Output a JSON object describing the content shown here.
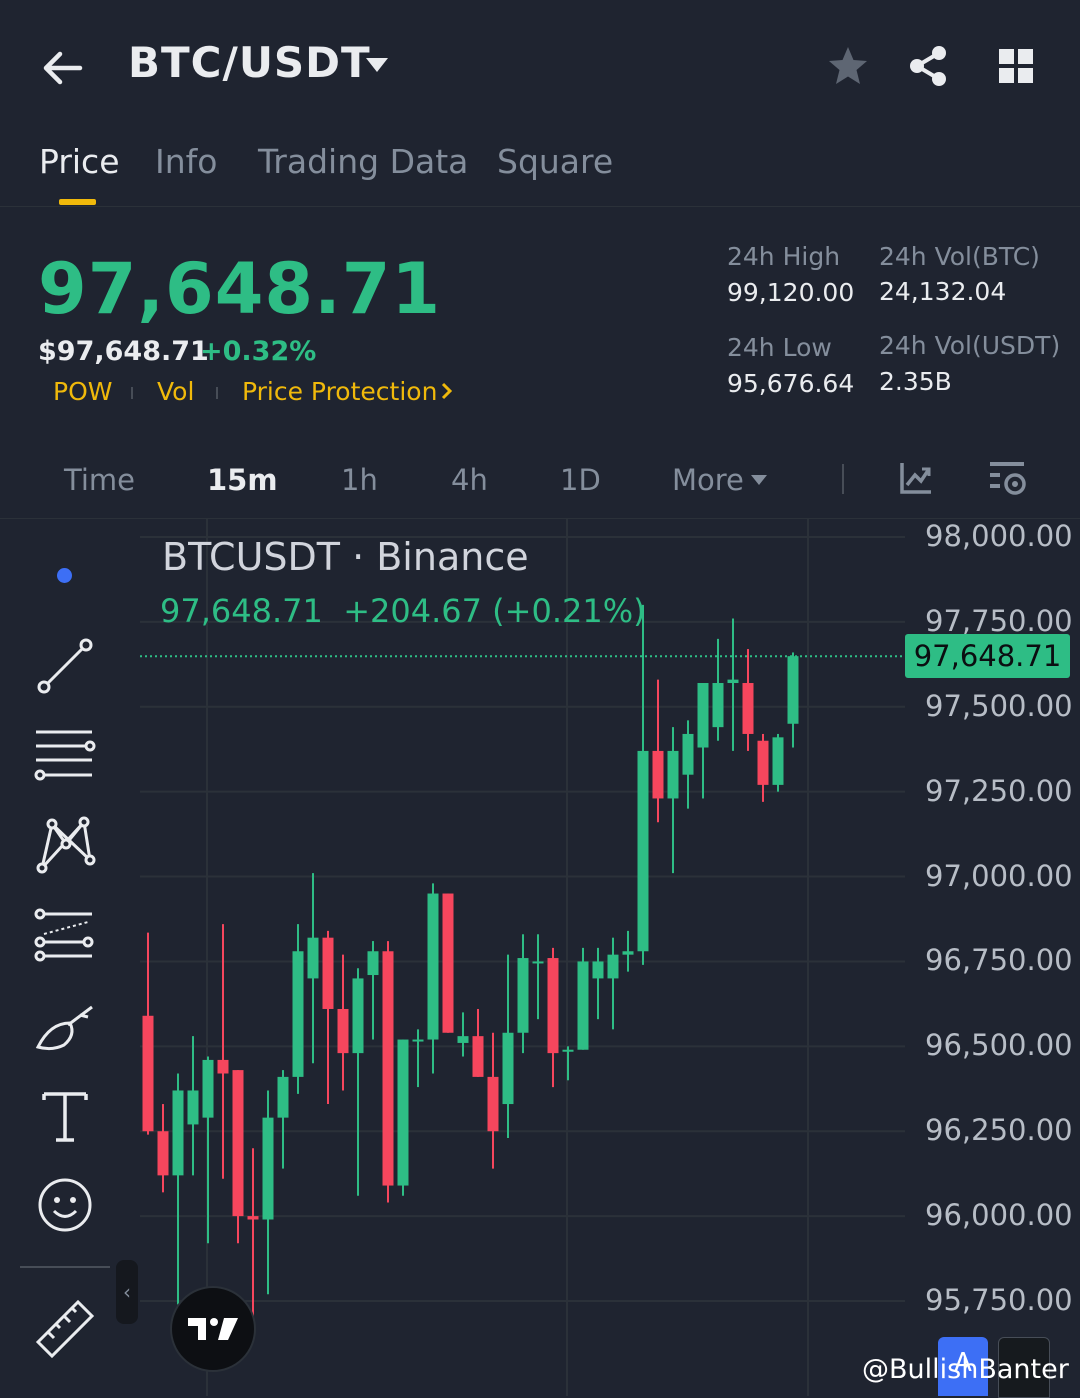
{
  "header": {
    "pair": "BTC/USDT",
    "tabs": [
      "Price",
      "Info",
      "Trading Data",
      "Square"
    ],
    "active_tab": "Price"
  },
  "ticker": {
    "last_price": "97,648.71",
    "usd_price": "$97,648.71",
    "change_pct": "+0.32%",
    "tags": [
      "POW",
      "Vol",
      "Price Protection"
    ],
    "stats": {
      "high_label": "24h High",
      "high_value": "99,120.00",
      "low_label": "24h Low",
      "low_value": "95,676.64",
      "vol_btc_label": "24h Vol(BTC)",
      "vol_btc_value": "24,132.04",
      "vol_usdt_label": "24h Vol(USDT)",
      "vol_usdt_value": "2.35B"
    }
  },
  "intervals": {
    "items": [
      "Time",
      "15m",
      "1h",
      "4h",
      "1D",
      "More"
    ],
    "active": "15m"
  },
  "chart": {
    "title": "BTCUSDT · Binance",
    "ohlc_line": "97,648.71  +204.67 (+0.21%)",
    "current_price_tag": "97,648.71",
    "current_price": 97648.71,
    "y_labels": [
      "98,000.00",
      "97,750.00",
      "97,500.00",
      "97,250.00",
      "97,000.00",
      "96,750.00",
      "96,500.00",
      "96,250.00",
      "96,000.00",
      "95,750.00"
    ],
    "y_values": [
      98000,
      97750,
      97500,
      97250,
      97000,
      96750,
      96500,
      96250,
      96000,
      95750
    ],
    "up_color": "#2ebd85",
    "down_color": "#f6465d"
  },
  "chart_data": {
    "type": "candlestick",
    "interval": "15m",
    "ylim": [
      95700,
      98050
    ],
    "candles": [
      {
        "o": 96590,
        "h": 96835,
        "l": 96240,
        "c": 96250
      },
      {
        "o": 96250,
        "h": 96330,
        "l": 96070,
        "c": 96120
      },
      {
        "o": 96120,
        "h": 96420,
        "l": 95740,
        "c": 96370
      },
      {
        "o": 96270,
        "h": 96530,
        "l": 96120,
        "c": 96370
      },
      {
        "o": 96290,
        "h": 96470,
        "l": 95920,
        "c": 96460
      },
      {
        "o": 96460,
        "h": 96860,
        "l": 96110,
        "c": 96420
      },
      {
        "o": 96430,
        "h": 96430,
        "l": 95920,
        "c": 96000
      },
      {
        "o": 96000,
        "h": 96200,
        "l": 95670,
        "c": 95990
      },
      {
        "o": 95990,
        "h": 96370,
        "l": 95770,
        "c": 96290
      },
      {
        "o": 96290,
        "h": 96430,
        "l": 96140,
        "c": 96410
      },
      {
        "o": 96410,
        "h": 96860,
        "l": 96360,
        "c": 96780
      },
      {
        "o": 96700,
        "h": 97010,
        "l": 96450,
        "c": 96820
      },
      {
        "o": 96820,
        "h": 96840,
        "l": 96330,
        "c": 96610
      },
      {
        "o": 96610,
        "h": 96770,
        "l": 96370,
        "c": 96480
      },
      {
        "o": 96480,
        "h": 96730,
        "l": 96060,
        "c": 96700
      },
      {
        "o": 96710,
        "h": 96810,
        "l": 96520,
        "c": 96780
      },
      {
        "o": 96780,
        "h": 96810,
        "l": 96040,
        "c": 96090
      },
      {
        "o": 96090,
        "h": 96520,
        "l": 96060,
        "c": 96520
      },
      {
        "o": 96520,
        "h": 96550,
        "l": 96380,
        "c": 96520
      },
      {
        "o": 96520,
        "h": 96980,
        "l": 96420,
        "c": 96950
      },
      {
        "o": 96950,
        "h": 96950,
        "l": 96540,
        "c": 96540
      },
      {
        "o": 96510,
        "h": 96600,
        "l": 96470,
        "c": 96530
      },
      {
        "o": 96530,
        "h": 96610,
        "l": 96410,
        "c": 96410
      },
      {
        "o": 96410,
        "h": 96540,
        "l": 96140,
        "c": 96250
      },
      {
        "o": 96330,
        "h": 96770,
        "l": 96230,
        "c": 96540
      },
      {
        "o": 96540,
        "h": 96830,
        "l": 96480,
        "c": 96760
      },
      {
        "o": 96750,
        "h": 96830,
        "l": 96580,
        "c": 96750
      },
      {
        "o": 96760,
        "h": 96790,
        "l": 96380,
        "c": 96480
      },
      {
        "o": 96490,
        "h": 96500,
        "l": 96400,
        "c": 96490
      },
      {
        "o": 96490,
        "h": 96790,
        "l": 96490,
        "c": 96750
      },
      {
        "o": 96700,
        "h": 96790,
        "l": 96580,
        "c": 96750
      },
      {
        "o": 96700,
        "h": 96820,
        "l": 96550,
        "c": 96770
      },
      {
        "o": 96770,
        "h": 96840,
        "l": 96720,
        "c": 96780
      },
      {
        "o": 96780,
        "h": 97800,
        "l": 96740,
        "c": 97370
      },
      {
        "o": 97370,
        "h": 97580,
        "l": 97160,
        "c": 97230
      },
      {
        "o": 97230,
        "h": 97440,
        "l": 97010,
        "c": 97370
      },
      {
        "o": 97300,
        "h": 97460,
        "l": 97200,
        "c": 97420
      },
      {
        "o": 97380,
        "h": 97570,
        "l": 97230,
        "c": 97570
      },
      {
        "o": 97440,
        "h": 97700,
        "l": 97400,
        "c": 97570
      },
      {
        "o": 97570,
        "h": 97760,
        "l": 97370,
        "c": 97580
      },
      {
        "o": 97570,
        "h": 97670,
        "l": 97370,
        "c": 97420
      },
      {
        "o": 97400,
        "h": 97420,
        "l": 97220,
        "c": 97270
      },
      {
        "o": 97270,
        "h": 97420,
        "l": 97250,
        "c": 97410
      },
      {
        "o": 97450,
        "h": 97660,
        "l": 97380,
        "c": 97649
      }
    ]
  },
  "toolbar": {
    "tools": [
      "trend-line",
      "horizontal-lines",
      "patterns",
      "fib-levels",
      "brush",
      "text",
      "emoji",
      "ruler"
    ]
  },
  "watermark": "@BullishBanter",
  "corner_buttons": {
    "a_label": "A"
  }
}
